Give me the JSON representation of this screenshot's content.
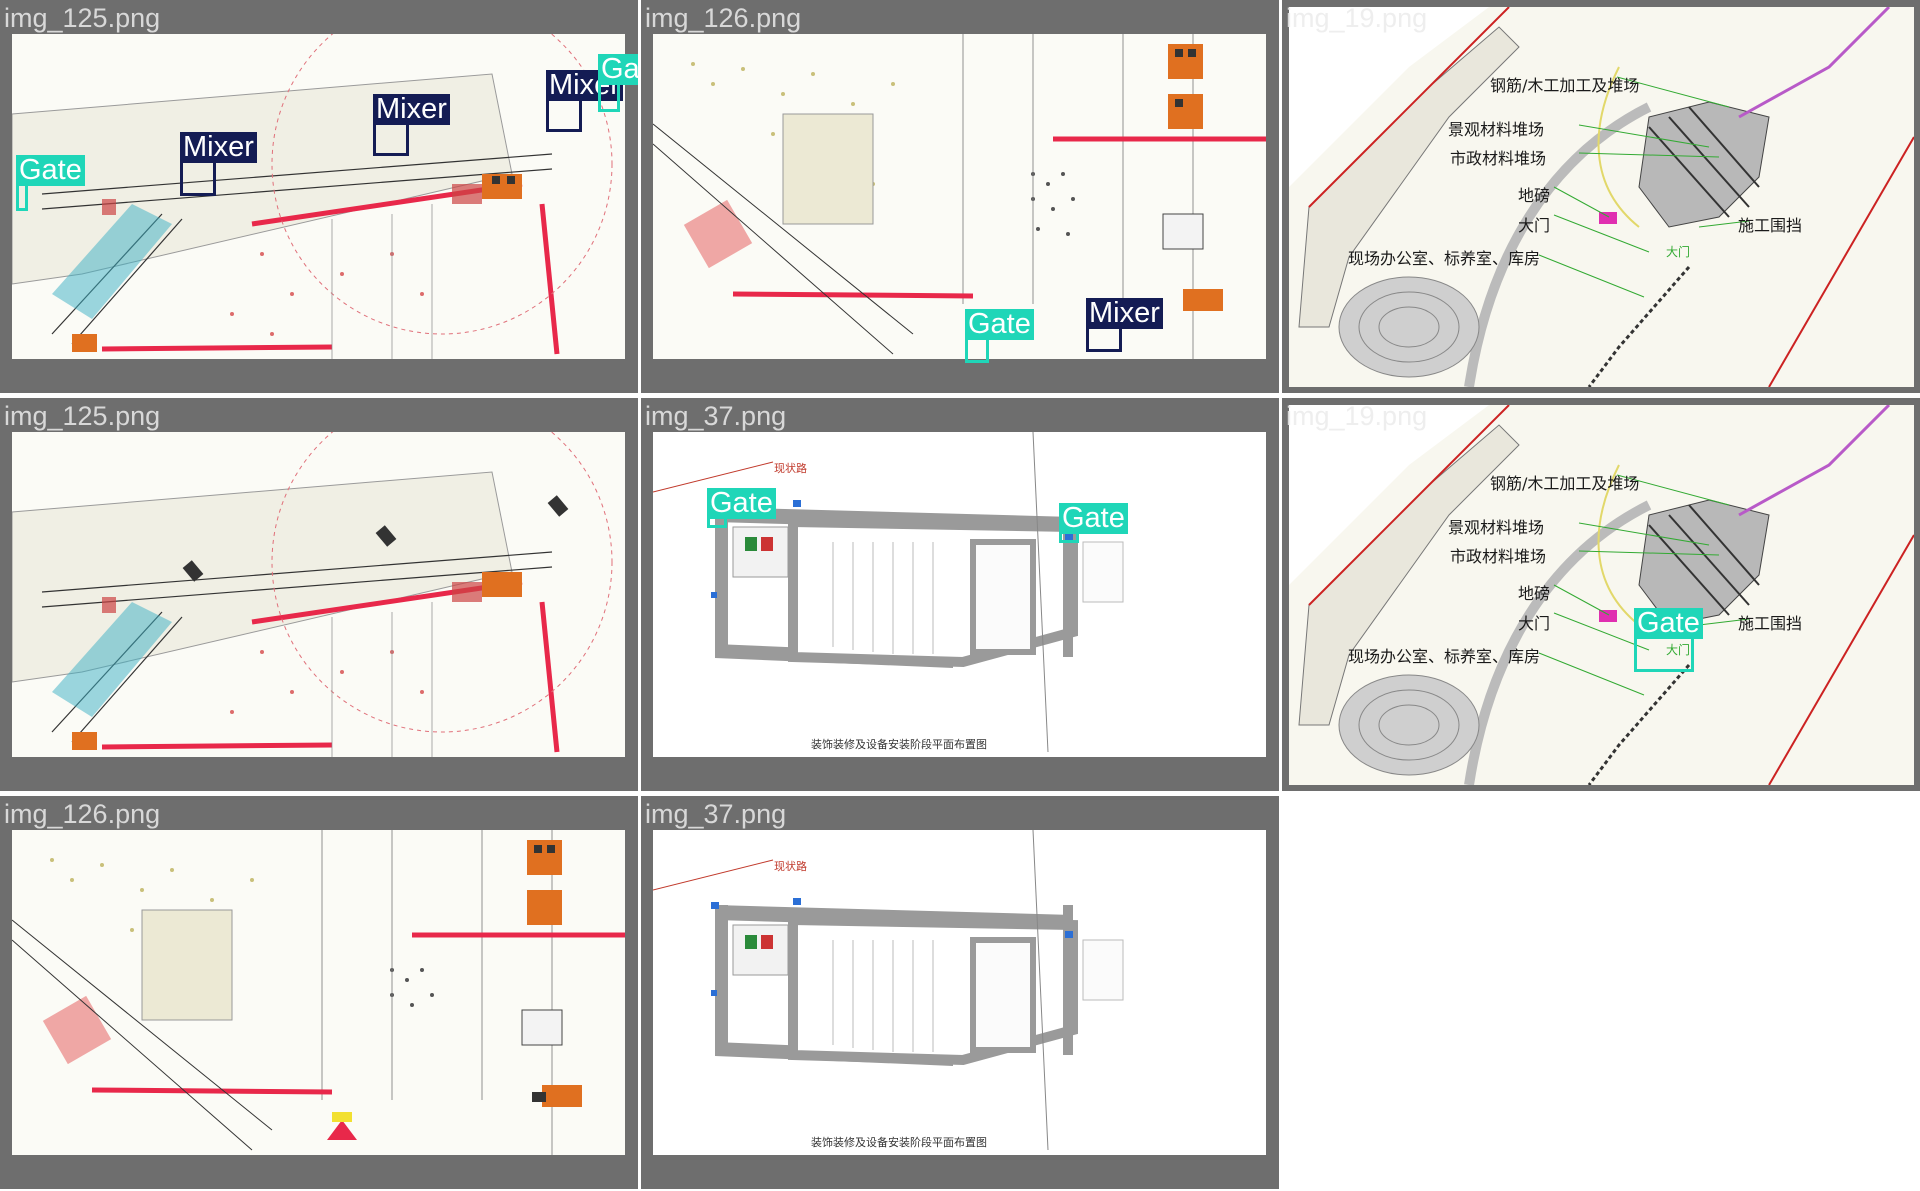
{
  "tiles": [
    {
      "file": "img_125.png"
    },
    {
      "file": "img_126.png"
    },
    {
      "file": "img_19.png"
    },
    {
      "file": "img_125.png"
    },
    {
      "file": "img_37.png"
    },
    {
      "file": "img_19.png"
    },
    {
      "file": "img_126.png"
    },
    {
      "file": "img_37.png"
    }
  ],
  "labels": {
    "gate": "Gate",
    "mixer": "Mixer"
  },
  "site_labels": {
    "rebar": "钢筋/木工加工及堆场",
    "landscape": "景观材料堆场",
    "municipal": "市政材料堆场",
    "weighbridge": "地磅",
    "gate": "大门",
    "office": "现场办公室、标养室、库房",
    "fence": "施工围挡",
    "gate_mark": "大门"
  },
  "plan": {
    "road": "现状路",
    "caption": "装饰装修及设备安装阶段平面布置图"
  },
  "colors": {
    "gate": "#1fd6b8",
    "mixer": "#141c54",
    "crane": "#e8284a",
    "tile_bg": "#6e6e6e"
  }
}
